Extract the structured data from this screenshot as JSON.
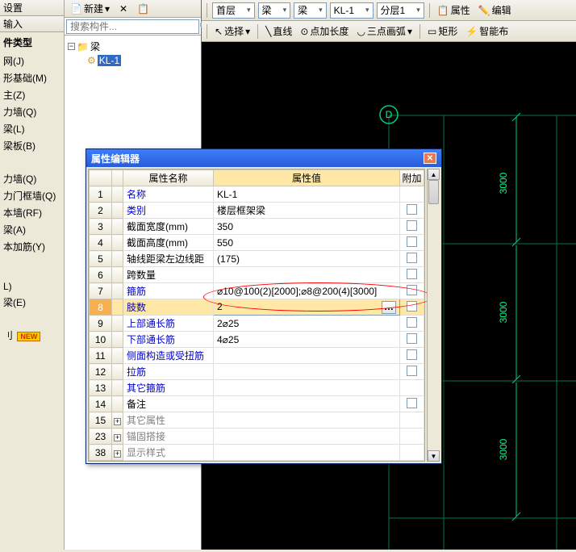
{
  "left": {
    "header": "设置",
    "input_label": "输入",
    "group1": "件类型",
    "items1": [
      "网(J)",
      "形基础(M)",
      "主(Z)",
      "力墙(Q)",
      "梁(L)",
      "梁板(B)"
    ],
    "group2": "",
    "items2": [
      "力墙(Q)",
      "力门框墙(Q)",
      "本墙(RF)",
      "梁(A)",
      "本加筋(Y)"
    ],
    "items3": [
      "L)",
      "梁(E)"
    ],
    "new_badge": "NEW"
  },
  "tree": {
    "new_btn": "新建",
    "search_placeholder": "搜索构件...",
    "root": "梁",
    "child": "KL-1"
  },
  "toolbar": {
    "combos": [
      "首层",
      "梁",
      "梁",
      "KL-1",
      "分层1"
    ],
    "attr_btn": "属性",
    "edit_btn": "编辑",
    "select_btn": "选择",
    "line_btn": "直线",
    "point_btn": "点加长度",
    "arc_btn": "三点画弧",
    "rect_btn": "矩形",
    "smart_btn": "智能布"
  },
  "cad": {
    "bubble": "D",
    "dims": [
      "3000",
      "3000",
      "3000"
    ]
  },
  "dialog": {
    "title": "属性编辑器",
    "col_name": "属性名称",
    "col_val": "属性值",
    "col_add": "附加",
    "rows": [
      {
        "n": "1",
        "name": "名称",
        "val": "KL-1",
        "link": true,
        "chk": false
      },
      {
        "n": "2",
        "name": "类别",
        "val": "楼层框架梁",
        "link": true,
        "chk": true
      },
      {
        "n": "3",
        "name": "截面宽度(mm)",
        "val": "350",
        "link": false,
        "chk": true
      },
      {
        "n": "4",
        "name": "截面高度(mm)",
        "val": "550",
        "link": false,
        "chk": true
      },
      {
        "n": "5",
        "name": "轴线距梁左边线距",
        "val": "(175)",
        "link": false,
        "chk": true
      },
      {
        "n": "6",
        "name": "跨数量",
        "val": "",
        "link": false,
        "chk": true
      },
      {
        "n": "7",
        "name": "箍筋",
        "val": "⌀10@100(2)[2000];⌀8@200(4)[3000]",
        "link": true,
        "chk": true
      },
      {
        "n": "8",
        "name": "肢数",
        "val": "2",
        "link": true,
        "chk": true,
        "sel": true,
        "btn": true
      },
      {
        "n": "9",
        "name": "上部通长筋",
        "val": "2⌀25",
        "link": true,
        "chk": true
      },
      {
        "n": "10",
        "name": "下部通长筋",
        "val": "4⌀25",
        "link": true,
        "chk": true
      },
      {
        "n": "11",
        "name": "侧面构造或受扭筋",
        "val": "",
        "link": true,
        "chk": true
      },
      {
        "n": "12",
        "name": "拉筋",
        "val": "",
        "link": true,
        "chk": true
      },
      {
        "n": "13",
        "name": "其它箍筋",
        "val": "",
        "link": true,
        "chk": false
      },
      {
        "n": "14",
        "name": "备注",
        "val": "",
        "link": false,
        "chk": true
      },
      {
        "n": "15",
        "name": "其它属性",
        "val": "",
        "gray": true,
        "exp": "+"
      },
      {
        "n": "23",
        "name": "锚固搭接",
        "val": "",
        "gray": true,
        "exp": "+"
      },
      {
        "n": "38",
        "name": "显示样式",
        "val": "",
        "gray": true,
        "exp": "+"
      }
    ]
  }
}
